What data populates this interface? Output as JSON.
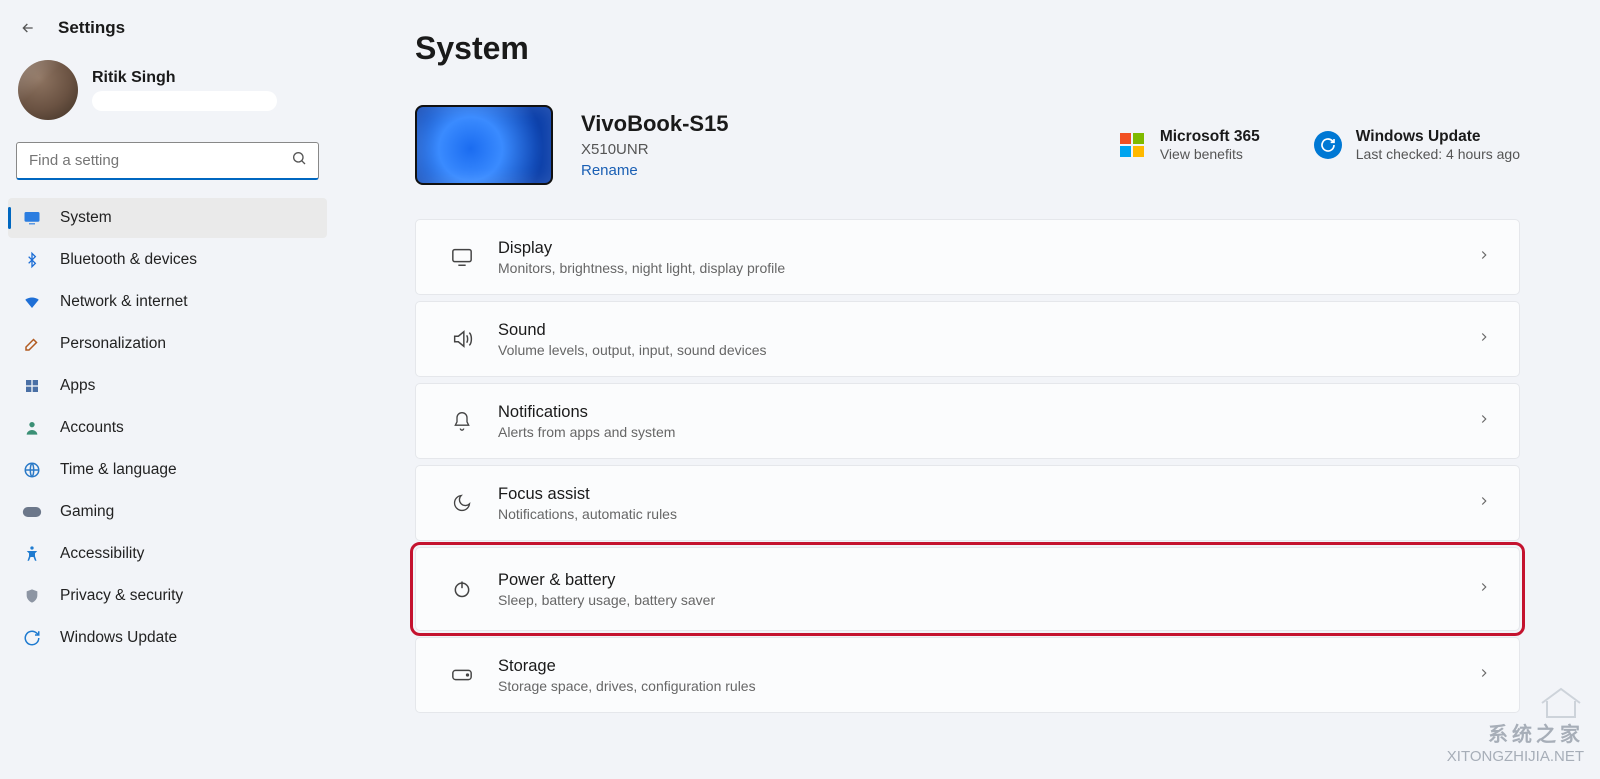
{
  "app_title": "Settings",
  "user": {
    "name": "Ritik Singh"
  },
  "search": {
    "placeholder": "Find a setting"
  },
  "sidebar": {
    "items": [
      {
        "label": "System",
        "icon": "💻",
        "selected": true
      },
      {
        "label": "Bluetooth & devices",
        "icon": "bt",
        "selected": false
      },
      {
        "label": "Network & internet",
        "icon": "wifi",
        "selected": false
      },
      {
        "label": "Personalization",
        "icon": "🖌️",
        "selected": false
      },
      {
        "label": "Apps",
        "icon": "apps",
        "selected": false
      },
      {
        "label": "Accounts",
        "icon": "👤",
        "selected": false
      },
      {
        "label": "Time & language",
        "icon": "🌐",
        "selected": false
      },
      {
        "label": "Gaming",
        "icon": "🎮",
        "selected": false
      },
      {
        "label": "Accessibility",
        "icon": "acc",
        "selected": false
      },
      {
        "label": "Privacy & security",
        "icon": "🛡️",
        "selected": false
      },
      {
        "label": "Windows Update",
        "icon": "upd",
        "selected": false
      }
    ]
  },
  "page": {
    "title": "System",
    "device": {
      "name": "VivoBook-S15",
      "model": "X510UNR",
      "rename": "Rename"
    },
    "tiles": {
      "ms365": {
        "title": "Microsoft 365",
        "sub": "View benefits"
      },
      "update": {
        "title": "Windows Update",
        "sub": "Last checked: 4 hours ago"
      }
    },
    "cards": [
      {
        "id": "display",
        "title": "Display",
        "sub": "Monitors, brightness, night light, display profile",
        "icon": "display"
      },
      {
        "id": "sound",
        "title": "Sound",
        "sub": "Volume levels, output, input, sound devices",
        "icon": "sound"
      },
      {
        "id": "notifications",
        "title": "Notifications",
        "sub": "Alerts from apps and system",
        "icon": "bell"
      },
      {
        "id": "focus-assist",
        "title": "Focus assist",
        "sub": "Notifications, automatic rules",
        "icon": "moon"
      },
      {
        "id": "power-battery",
        "title": "Power & battery",
        "sub": "Sleep, battery usage, battery saver",
        "icon": "power",
        "highlight": true
      },
      {
        "id": "storage",
        "title": "Storage",
        "sub": "Storage space, drives, configuration rules",
        "icon": "storage"
      }
    ]
  },
  "watermark": {
    "cn": "系统之家",
    "url": "XITONGZHIJIA.NET"
  }
}
